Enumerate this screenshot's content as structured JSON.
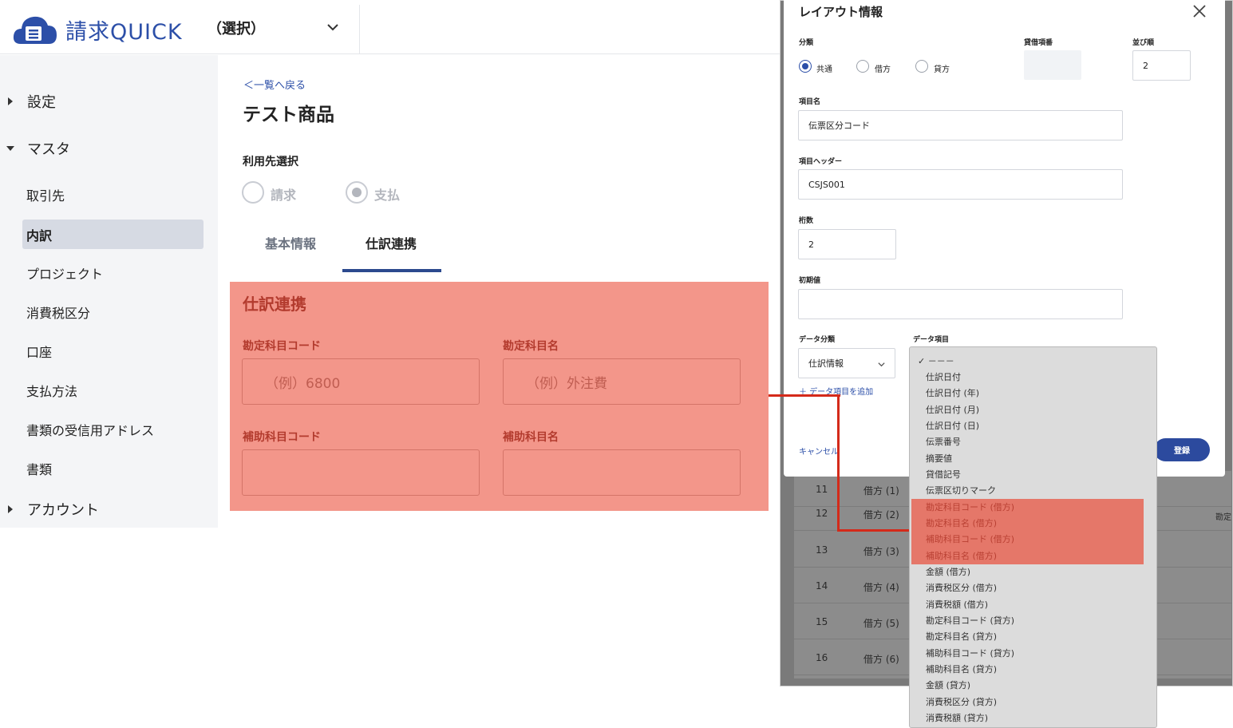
{
  "colors": {
    "accent": "#2c4fa8",
    "highlight": "#f3968a",
    "highlight_text": "#b33b2e",
    "connector": "#d42a1a"
  },
  "header": {
    "logo_text": "請求QUICK",
    "company_select": "（選択）"
  },
  "sidebar": {
    "groups": [
      {
        "label": "設定",
        "expanded": false
      },
      {
        "label": "マスタ",
        "expanded": true
      },
      {
        "label": "アカウント",
        "expanded": false
      }
    ],
    "items": [
      "取引先",
      "内訳",
      "プロジェクト",
      "消費税区分",
      "口座",
      "支払方法",
      "書類の受信用アドレス",
      "書類"
    ],
    "active_item": "内訳"
  },
  "main": {
    "back_link": "一覧へ戻る",
    "title": "テスト商品",
    "usage_label": "利用先選択",
    "usage_options": [
      "請求",
      "支払"
    ],
    "usage_selected": "支払",
    "tabs": [
      {
        "label": "基本情報",
        "active": false
      },
      {
        "label": "仕訳連携",
        "active": true
      }
    ],
    "journal": {
      "title": "仕訳連携",
      "account_code_label": "勘定科目コード",
      "account_code_placeholder": "（例）6800",
      "account_name_label": "勘定科目名",
      "account_name_placeholder": "（例）外注費",
      "sub_code_label": "補助科目コード",
      "sub_name_label": "補助科目名"
    }
  },
  "modal": {
    "title": "レイアウト情報",
    "category_label": "分類",
    "category_options": [
      "共通",
      "借方",
      "貸方"
    ],
    "category_selected": "共通",
    "credit_label": "貸借項番",
    "order_label": "並び順",
    "order_value": "2",
    "item_name_label": "項目名",
    "item_name_value": "伝票区分コード",
    "item_header_label": "項目ヘッダー",
    "item_header_value": "CSJS001",
    "digits_label": "桁数",
    "digits_value": "2",
    "initial_label": "初期値",
    "initial_value": "",
    "data_category_label": "データ分類",
    "data_category_value": "仕訳情報",
    "data_item_label": "データ項目",
    "add_data_link": "＋ データ項目を追加",
    "cancel": "キャンセル",
    "register": "登録"
  },
  "dropdown": {
    "selected": "－－－",
    "options": [
      "仕訳日付",
      "仕訳日付 (年)",
      "仕訳日付 (月)",
      "仕訳日付 (日)",
      "伝票番号",
      "摘要値",
      "貸借記号",
      "伝票区切りマーク",
      "勘定科目コード (借方)",
      "勘定科目名 (借方)",
      "補助科目コード (借方)",
      "補助科目名 (借方)",
      "金額 (借方)",
      "消費税区分 (借方)",
      "消費税額 (借方)",
      "勘定科目コード (貸方)",
      "勘定科目名 (貸方)",
      "補助科目コード (貸方)",
      "補助科目名 (貸方)",
      "金額 (貸方)",
      "消費税区分 (貸方)",
      "消費税額 (貸方)"
    ],
    "highlighted": [
      "勘定科目コード (借方)",
      "勘定科目名 (借方)",
      "補助科目コード (借方)",
      "補助科目名 (借方)"
    ]
  },
  "background_table": {
    "rows": [
      {
        "no": "11",
        "side": "借方 (1)"
      },
      {
        "no": "12",
        "side": "借方 (2)"
      },
      {
        "no": "13",
        "side": "借方 (3)"
      },
      {
        "no": "14",
        "side": "借方 (4)"
      },
      {
        "no": "15",
        "side": "借方 (5)"
      },
      {
        "no": "16",
        "side": "借方 (6)"
      }
    ],
    "right_text": "勘定"
  }
}
